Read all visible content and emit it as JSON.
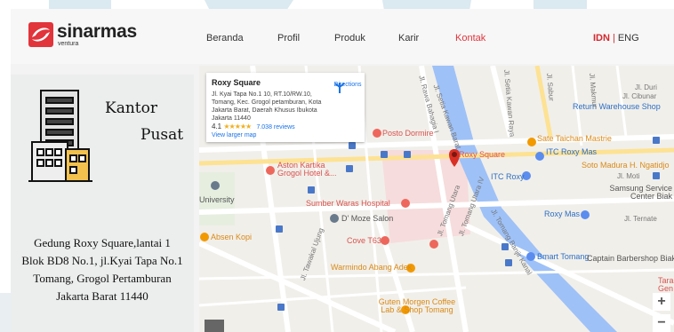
{
  "header": {
    "brand": "sinarmas",
    "brand_sub": "ventura",
    "nav": [
      {
        "label": "Beranda"
      },
      {
        "label": "Profil"
      },
      {
        "label": "Produk"
      },
      {
        "label": "Karir"
      },
      {
        "label": "Kontak",
        "active": true
      }
    ],
    "lang_current": "IDN",
    "lang_sep": "|",
    "lang_other": "ENG"
  },
  "office": {
    "title_line1": "Kantor",
    "title_line2": "Pusat",
    "address": [
      "Gedung Roxy Square,lantai 1",
      "Blok BD8 No.1, jl.Kyai Tapa No.1",
      "Tomang, Grogol Pertamburan",
      "Jakarta Barat 11440"
    ]
  },
  "map": {
    "card": {
      "title": "Roxy Square",
      "address": "Jl. Kyai Tapa No.1 10, RT.10/RW.10, Tomang, Kec. Grogol petamburan, Kota Jakarta Barat, Daerah Khusus Ibukota Jakarta 11440",
      "rating": "4.1",
      "stars": "★★★★★",
      "reviews": "7.038 reviews",
      "directions": "Directions",
      "larger_map": "View larger map"
    },
    "labels": {
      "roxy_square": "Roxy Square",
      "posto_dormire": "Posto Dormire",
      "sate_taichan": "Sate Taichan Mastrie",
      "itc_roxy_mas": "ITC Roxy Mas",
      "itc_roxy": "ITC Roxy",
      "aston": "Aston Kartika Grogol Hotel &...",
      "sumber_waras": "Sumber Waras Hospital",
      "d_moze": "D' Moze Salon",
      "absen_kopi": "Absen Kopi",
      "cove": "Cove T63",
      "warmindo": "Warmindo Abang Adek",
      "guten_morgen": "Guten Morgen Coffee Lab & Shop Tomang",
      "roxy_mas": "Roxy Mas",
      "bmart": "Bmart Tomang",
      "captain": "Captain Barbershop Biak",
      "soto": "Soto Madura H. Ngatidjo",
      "samsung": "Samsung Service Center Biak",
      "return": "Return Warehouse Shop",
      "university": "University",
      "st_jl_duri": "Jl. Duri",
      "st_cibunar": "Jl. Cibunar",
      "st_moti": "Jl. Moti",
      "st_ternate": "Jl. Ternate",
      "st_setia_kawan_barat": "Jl. Setia Kawan Barat",
      "st_setia_kawan_raya": "Jl. Setia Kawan Raya",
      "st_sabur": "Jl. Sabur",
      "st_makmur": "Jl. Makmur",
      "st_rawa_bahagia": "Jl. Rawa Bahagia I",
      "st_tawakal": "Jl. Tawakal Ujung",
      "st_tomang_utara": "Jl. Tomang Utara",
      "st_tomang_utara_iv": "Jl. Tomang Utara IV",
      "st_tomang_banjir": "Jl. Tomang Banjir Kanal",
      "tara_gen": "Tara Gen"
    },
    "zoom_in": "+",
    "zoom_out": "−"
  },
  "colors": {
    "accent_red": "#e1343b",
    "map_bg": "#f1efea",
    "canal": "#9ec1f7",
    "hospital_area": "#f6dcdc"
  }
}
